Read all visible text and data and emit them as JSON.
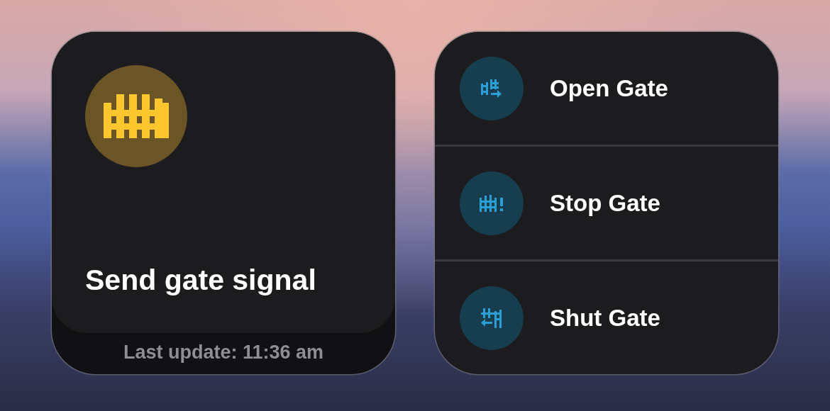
{
  "tile": {
    "title": "Send gate signal",
    "footer": "Last update: 11:36 am"
  },
  "actions": [
    {
      "kind": "open",
      "label": "Open Gate"
    },
    {
      "kind": "stop",
      "label": "Stop Gate"
    },
    {
      "kind": "shut",
      "label": "Shut Gate"
    }
  ]
}
